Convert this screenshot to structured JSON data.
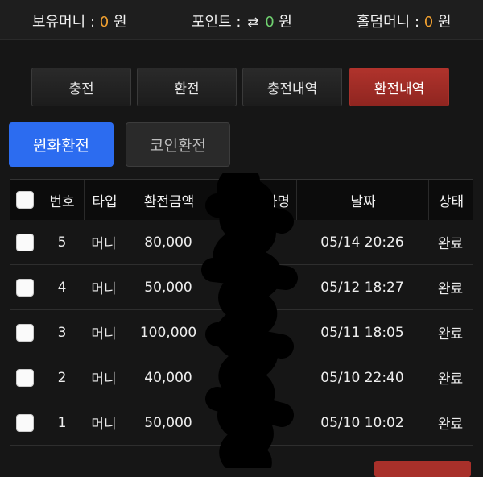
{
  "topbar": {
    "balance_label": "보유머니 :",
    "balance_value": "0",
    "balance_unit": "원",
    "points_label": "포인트 :",
    "points_icon": "swap-arrows-icon",
    "points_value": "0",
    "points_unit": "원",
    "holdem_label": "홀덤머니 :",
    "holdem_value": "0",
    "holdem_unit": "원"
  },
  "tabs": [
    {
      "label": "충전",
      "active": false
    },
    {
      "label": "환전",
      "active": false
    },
    {
      "label": "충전내역",
      "active": false
    },
    {
      "label": "환전내역",
      "active": true
    }
  ],
  "subtabs": [
    {
      "label": "원화환전",
      "active": true
    },
    {
      "label": "코인환전",
      "active": false
    }
  ],
  "table": {
    "headers": {
      "number": "번호",
      "type": "타입",
      "amount": "환전금액",
      "depositor": "자명",
      "date": "날짜",
      "status": "상태"
    },
    "rows": [
      {
        "number": "5",
        "type": "머니",
        "amount": "80,000",
        "date": "05/14 20:26",
        "status": "완료"
      },
      {
        "number": "4",
        "type": "머니",
        "amount": "50,000",
        "date": "05/12 18:27",
        "status": "완료"
      },
      {
        "number": "3",
        "type": "머니",
        "amount": "100,000",
        "date": "05/11 18:05",
        "status": "완료"
      },
      {
        "number": "2",
        "type": "머니",
        "amount": "40,000",
        "date": "05/10 22:40",
        "status": "완료"
      },
      {
        "number": "1",
        "type": "머니",
        "amount": "50,000",
        "date": "05/10 10:02",
        "status": "완료"
      }
    ]
  },
  "colors": {
    "accent_red": "#a8302a",
    "accent_blue": "#2c6cf0",
    "value_orange": "#f0a030",
    "value_green": "#6fd06f"
  }
}
